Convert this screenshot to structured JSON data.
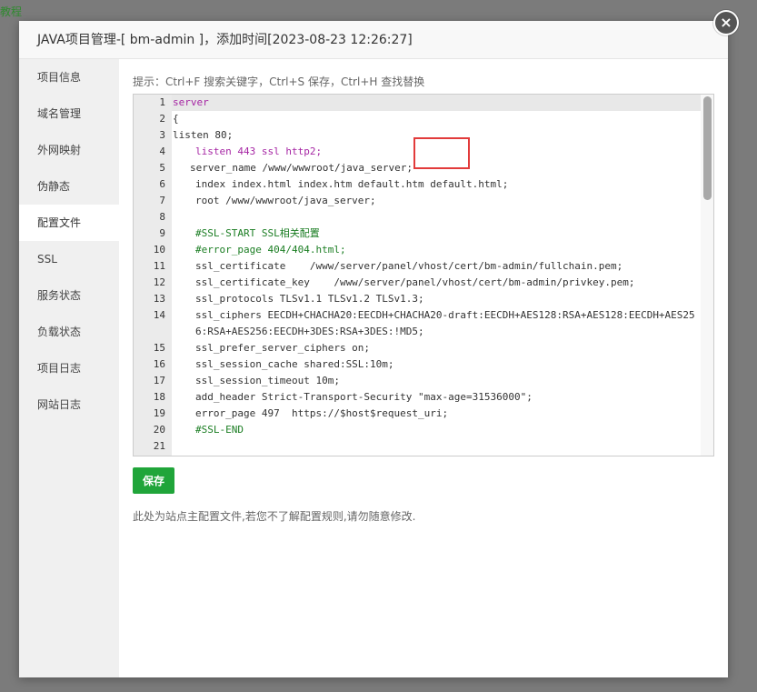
{
  "backdrop": {
    "link_text": "教程"
  },
  "dialog": {
    "title": "JAVA项目管理-[ bm-admin ]，添加时间[2023-08-23 12:26:27]",
    "close_glyph": "×"
  },
  "sidebar": {
    "items": [
      {
        "label": "项目信息",
        "active": false
      },
      {
        "label": "域名管理",
        "active": false
      },
      {
        "label": "外网映射",
        "active": false
      },
      {
        "label": "伪静态",
        "active": false
      },
      {
        "label": "配置文件",
        "active": true
      },
      {
        "label": "SSL",
        "active": false
      },
      {
        "label": "服务状态",
        "active": false
      },
      {
        "label": "负载状态",
        "active": false
      },
      {
        "label": "项目日志",
        "active": false
      },
      {
        "label": "网站日志",
        "active": false
      }
    ]
  },
  "content": {
    "tip": "提示：Ctrl+F 搜索关键字，Ctrl+S 保存，Ctrl+H 查找替换",
    "save_label": "保存",
    "note": "此处为站点主配置文件,若您不了解配置规则,请勿随意修改."
  },
  "editor": {
    "lines": [
      {
        "num": "1",
        "text": "server"
      },
      {
        "num": "2",
        "text": "{"
      },
      {
        "num": "3",
        "text": "listen 80;"
      },
      {
        "num": "4",
        "text": "listen 443 ssl http2;"
      },
      {
        "num": "5",
        "text": "server_name /www/wwwroot/java_server;"
      },
      {
        "num": "6",
        "text": "index index.html index.htm default.htm default.html;"
      },
      {
        "num": "7",
        "text": "root /www/wwwroot/java_server;"
      },
      {
        "num": "8",
        "text": ""
      },
      {
        "num": "9",
        "text": "#SSL-START SSL相关配置"
      },
      {
        "num": "10",
        "text": "#error_page 404/404.html;"
      },
      {
        "num": "11",
        "text": "ssl_certificate    /www/server/panel/vhost/cert/bm-admin/fullchain.pem;"
      },
      {
        "num": "12",
        "text": "ssl_certificate_key    /www/server/panel/vhost/cert/bm-admin/privkey.pem;"
      },
      {
        "num": "13",
        "text": "ssl_protocols TLSv1.1 TLSv1.2 TLSv1.3;"
      },
      {
        "num": "14",
        "text": "ssl_ciphers EECDH+CHACHA20:EECDH+CHACHA20-draft:EECDH+AES128:RSA+AES128:EECDH+AES256:RSA+AES256:EECDH+3DES:RSA+3DES:!MD5;"
      },
      {
        "num": "15",
        "text": "ssl_prefer_server_ciphers on;"
      },
      {
        "num": "16",
        "text": "ssl_session_cache shared:SSL:10m;"
      },
      {
        "num": "17",
        "text": "ssl_session_timeout 10m;"
      },
      {
        "num": "18",
        "text": "add_header Strict-Transport-Security \"max-age=31536000\";"
      },
      {
        "num": "19",
        "text": "error_page 497  https://$host$request_uri;"
      },
      {
        "num": "20",
        "text": "#SSL-END"
      },
      {
        "num": "21",
        "text": ""
      }
    ]
  },
  "colors": {
    "accent_green": "#20a53a",
    "highlight_box": "#e23b3b"
  }
}
